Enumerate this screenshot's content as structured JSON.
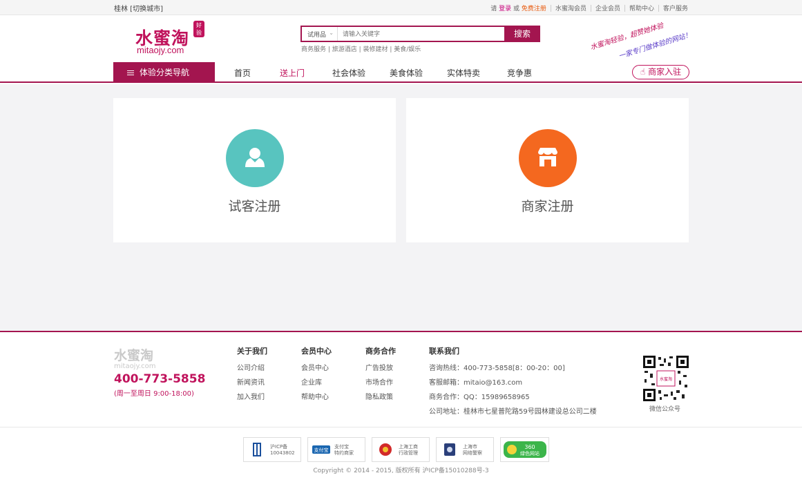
{
  "topbar": {
    "city": "桂林 [切换城市]",
    "please": "请",
    "login": "登录",
    "or": "或",
    "register": "免费注册",
    "links": [
      "水蜜淘会员",
      "企业会员",
      "帮助中心",
      "客户服务"
    ]
  },
  "logo": {
    "cn": "水蜜淘",
    "en": "mitaojy.com",
    "badge": "好验"
  },
  "search": {
    "category": "试用品",
    "placeholder": "请输入关键字",
    "button": "搜索",
    "hot": "商务服务 | 旅游酒店 | 装修建材 | 美食/娱乐"
  },
  "slogan": {
    "line1": "水蜜淘轻验，超赞她体验",
    "line2": "一家专门做体验的网站！"
  },
  "nav": {
    "category_button": "体验分类导航",
    "items": [
      "首页",
      "送上门",
      "社会体验",
      "美食体验",
      "实体特卖",
      "竞争惠"
    ],
    "merchant_button": "商家入驻"
  },
  "cards": [
    {
      "label": "试客注册",
      "color": "#58c4bf",
      "icon": "person-icon"
    },
    {
      "label": "商家注册",
      "color": "#f4681f",
      "icon": "store-icon"
    }
  ],
  "footer": {
    "logo_cn": "水蜜淘",
    "logo_en": "mitaojy.com",
    "phone": "400-773-5858",
    "hours": "(周一至周日 9:00-18:00)",
    "columns": [
      {
        "title": "关于我们",
        "links": [
          "公司介绍",
          "新闻资讯",
          "加入我们"
        ]
      },
      {
        "title": "会员中心",
        "links": [
          "会员中心",
          "企业库",
          "帮助中心"
        ]
      },
      {
        "title": "商务合作",
        "links": [
          "广告投放",
          "市场合作",
          "隐私政策"
        ]
      }
    ],
    "contact": {
      "title": "联系我们",
      "lines": [
        "咨询热线：400-773-5858[8：00-20：00]",
        "客服邮箱：mitaio@163.com",
        "商务合作：QQ：15989658965",
        "公司地址：桂林市七星普陀路59号园林建设总公司二楼"
      ]
    },
    "qr_label": "微信公众号",
    "certs": [
      {
        "line1": "沪ICP备",
        "line2": "10043802"
      },
      {
        "line1": "支付宝",
        "line2": "特约商家"
      },
      {
        "line1": "上海工商",
        "line2": "行政管理"
      },
      {
        "line1": "上海市",
        "line2": "网络警察"
      },
      {
        "line1": "360",
        "line2": "绿色网站"
      }
    ],
    "copyright": "Copyright © 2014 - 2015, 版权所有 沪ICP备15010288号-3"
  },
  "colors": {
    "brand": "#a3154f",
    "teal": "#58c4bf",
    "orange": "#f4681f"
  }
}
